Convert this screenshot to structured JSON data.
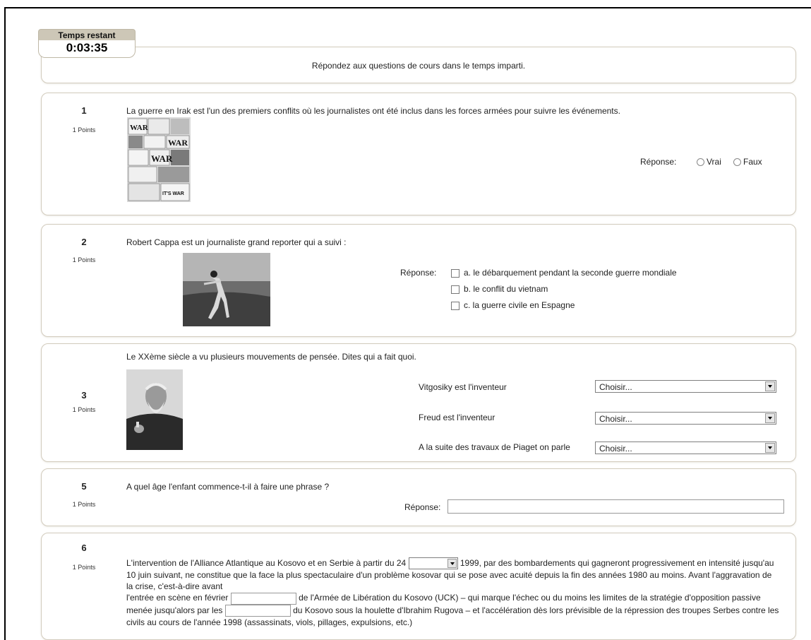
{
  "timer": {
    "label": "Temps restant",
    "value": "0:03:35"
  },
  "instructions": "Répondez aux questions de cours dans le temps imparti.",
  "questions": {
    "q1": {
      "number": "1",
      "points": "1 Points",
      "text": "La guerre en Irak est l'un des premiers conflits où les journalistes ont été inclus dans les forces armées pour suivre les événements.",
      "answer_label": "Réponse:",
      "options": [
        "Vrai",
        "Faux"
      ],
      "image_text": [
        "WAR",
        "WAR",
        "WAR",
        "IT'S WAR"
      ]
    },
    "q2": {
      "number": "2",
      "points": "1 Points",
      "text": "Robert Cappa est un journaliste grand reporter qui a suivi :",
      "answer_label": "Réponse:",
      "options": [
        "a. le débarquement pendant la seconde guerre mondiale",
        "b. le conflit du vietnam",
        "c. la guerre civile en Espagne"
      ]
    },
    "q3": {
      "number": "3",
      "points": "1 Points",
      "text": "Le XXème siècle a vu plusieurs mouvements de pensée. Dites qui a fait quoi.",
      "rows": [
        {
          "label": "Vitgosiky est l'inventeur",
          "select": "Choisir..."
        },
        {
          "label": "Freud est l'inventeur",
          "select": "Choisir..."
        },
        {
          "label": "A la suite des travaux de Piaget on parle",
          "select": "Choisir..."
        }
      ]
    },
    "q5": {
      "number": "5",
      "points": "1 Points",
      "text": "A quel âge l'enfant commence-t-il à faire une phrase ?",
      "answer_label": "Réponse:"
    },
    "q6": {
      "number": "6",
      "points": "1 Points",
      "part1": "L'intervention de l'Alliance Atlantique au Kosovo et en Serbie à partir du 24",
      "part2": "1999, par des bombardements qui gagneront progressivement en intensité jusqu'au 10 juin suivant, ne constitue que la face la plus spectaculaire d'un problème kosovar qui se pose avec acuité depuis la fin des années 1980 au moins. Avant l'aggravation de la crise, c'est-à-dire avant",
      "part3": "l'entrée en scène en février",
      "part4": "de l'Armée de Libération du Kosovo (UCK) – qui marque l'échec ou du moins les limites de la stratégie d'opposition passive menée jusqu'alors par les",
      "part5": "du Kosovo sous la houlette d'Ibrahim Rugova – et l'accélération dès lors prévisible de la répression des troupes Serbes contre les civils au cours de l'année 1998 (assassinats, viols, pillages, expulsions, etc.)"
    }
  }
}
